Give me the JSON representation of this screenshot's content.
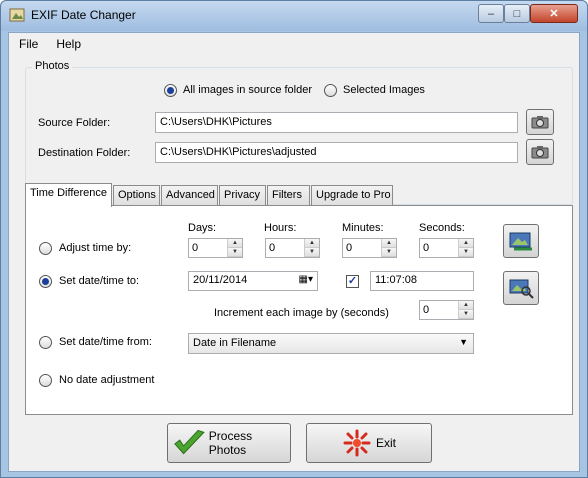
{
  "window": {
    "title": "EXIF Date Changer",
    "controls": {
      "minimize": "–",
      "maximize": "□",
      "close": "✕"
    }
  },
  "menu": [
    "File",
    "Help"
  ],
  "photos": {
    "legend": "Photos",
    "radio_all": "All images in source folder",
    "radio_selected": "Selected Images",
    "selected_mode": "all",
    "source_label": "Source Folder:",
    "source_value": "C:\\Users\\DHK\\Pictures",
    "dest_label": "Destination Folder:",
    "dest_value": "C:\\Users\\DHK\\Pictures\\adjusted"
  },
  "tabs": [
    "Time Difference",
    "Options",
    "Advanced",
    "Privacy",
    "Filters",
    "Upgrade to Pro"
  ],
  "active_tab": "Time Difference",
  "time_difference": {
    "headers": {
      "days": "Days:",
      "hours": "Hours:",
      "minutes": "Minutes:",
      "seconds": "Seconds:"
    },
    "adjust_label": "Adjust time by:",
    "values": {
      "days": "0",
      "hours": "0",
      "minutes": "0",
      "seconds": "0"
    },
    "set_label": "Set date/time to:",
    "set_date": "20/11/2014",
    "set_time_checked": true,
    "set_time": "11:07:08",
    "increment_label": "Increment each image by (seconds)",
    "increment_value": "0",
    "from_label": "Set date/time from:",
    "from_value": "Date in Filename",
    "none_label": "No date adjustment",
    "selected_mode": "set"
  },
  "buttons": {
    "process": "Process Photos",
    "exit": "Exit"
  }
}
